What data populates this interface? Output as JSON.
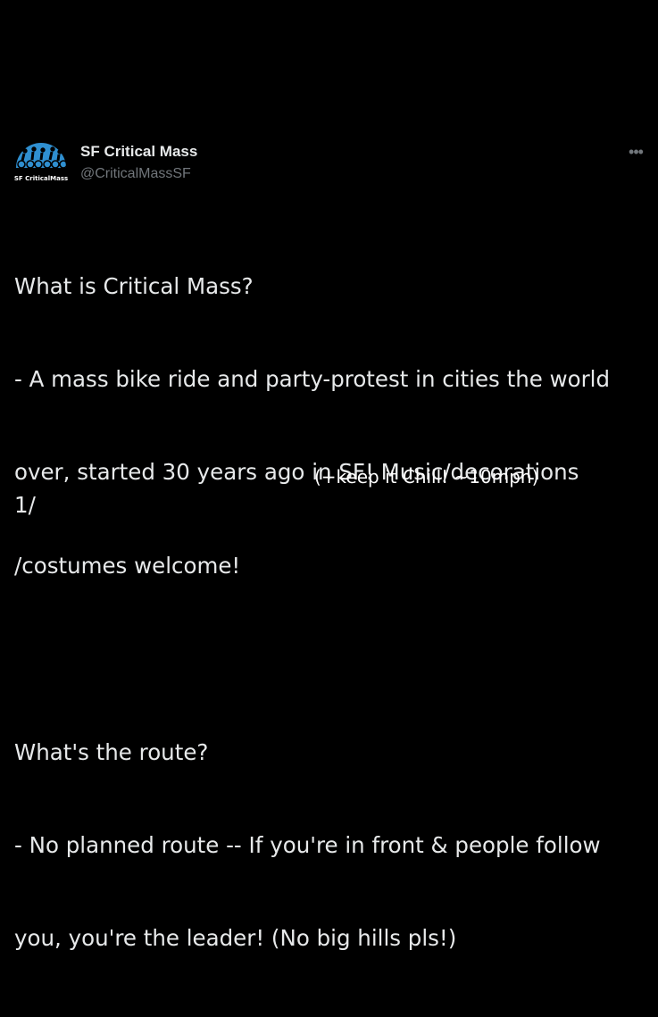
{
  "author": {
    "display_name": "SF Critical Mass",
    "handle": "@CriticalMassSF",
    "avatar_logo_text": "SF CriticalMass"
  },
  "more_icon": "more-horizontal-icon",
  "tweet": {
    "lines": [
      "What is Critical Mass?",
      "- A mass bike ride and party-protest in cities the world",
      "over, started 30 years ago in SF! Music/decorations",
      "/costumes welcome!",
      "",
      "What's the route?",
      "- No planned route -- If you're in front & people follow",
      "you, you're the leader! (No big hills pls!)"
    ],
    "annotation": "(+keep it Chill! ~10mph)",
    "thread_count": "1/"
  },
  "colors": {
    "background": "#000000",
    "text": "#e7e9ea",
    "secondary": "#71767b",
    "avatar_sky": "#2f8fd0"
  }
}
